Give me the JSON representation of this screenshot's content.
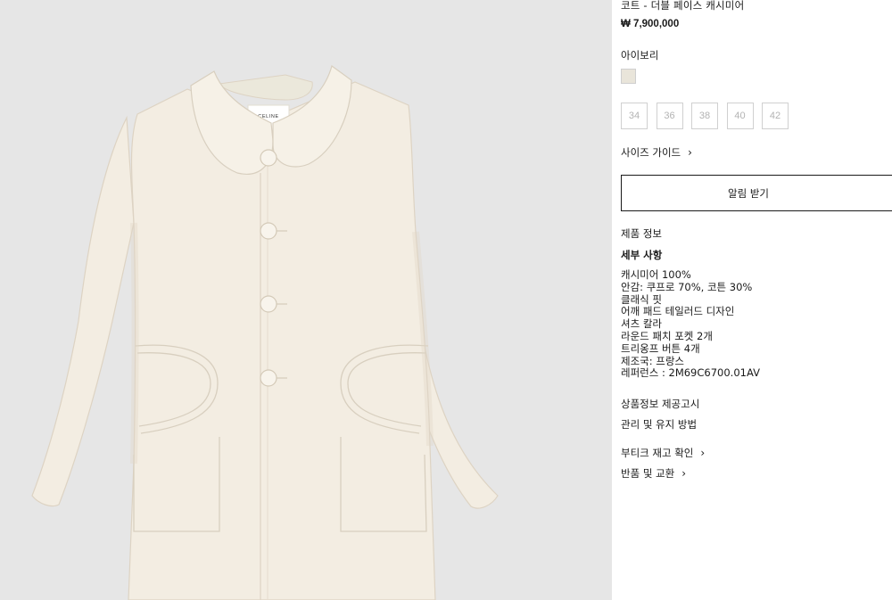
{
  "product": {
    "title": "코트 - 더블 페이스 캐시미어",
    "price": "₩ 7,900,000",
    "color_name": "아이보리",
    "swatch_color": "#e9e5da",
    "sizes": [
      "34",
      "36",
      "38",
      "40",
      "42"
    ],
    "size_guide_label": "사이즈 가이드",
    "notify_label": "알림 받기",
    "product_info_label": "제품 정보",
    "details_heading": "세부 사항",
    "details": [
      "캐시미어 100%",
      "안감: 쿠프로 70%, 코튼 30%",
      "클래식 핏",
      "어깨 패드 테일러드 디자인",
      "셔츠 칼라",
      "라운드 패치 포켓 2개",
      "트리옹프 버튼 4개",
      "제조국: 프랑스",
      "레퍼런스 : 2M69C6700.01AV"
    ],
    "notice_label": "상품정보 제공고시",
    "care_label": "관리 및 유지 방법",
    "boutique_stock_label": "부티크 재고 확인",
    "returns_label": "반품 및 교환"
  },
  "image": {
    "background": "#e6e6e6",
    "coat_color": "#f3ede2",
    "brand_label": "CELINE"
  },
  "icons": {
    "chevron": "chevron-right-icon"
  }
}
